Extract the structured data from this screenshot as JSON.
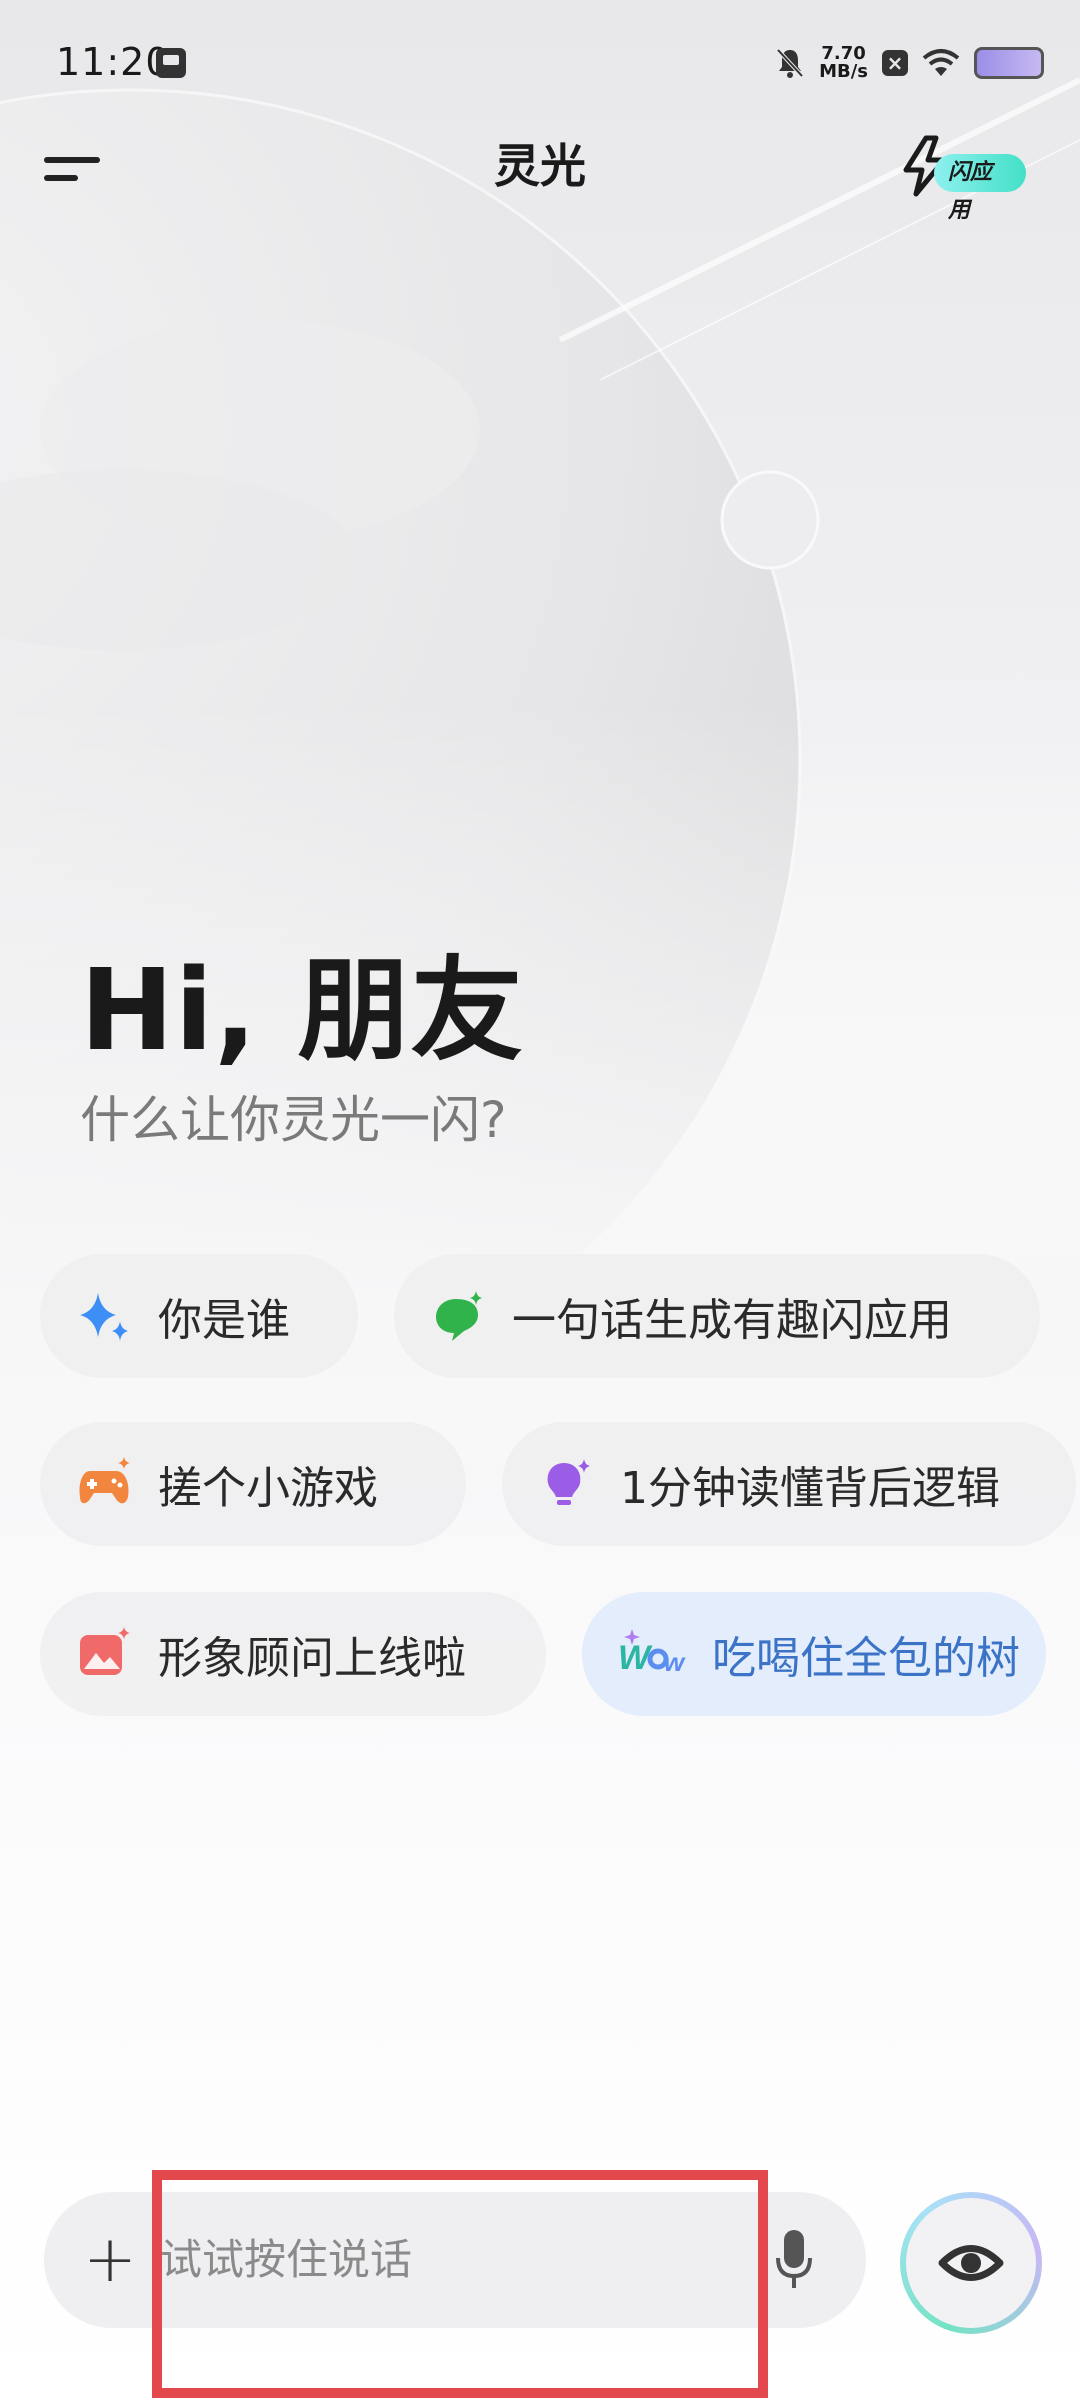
{
  "status_bar": {
    "time": "11:20",
    "speed_value": "7.70",
    "speed_unit": "MB/s",
    "icons": [
      "screenshot-icon",
      "mute-bell-icon",
      "notification-x-icon",
      "wifi-icon",
      "battery-icon"
    ]
  },
  "header": {
    "title": "灵光",
    "flash_app_label": "闪应用"
  },
  "greeting": {
    "title": "Hi, 朋友",
    "subtitle": "什么让你灵光一闪?"
  },
  "suggestions": [
    {
      "label": "你是谁",
      "icon": "sparkle-icon"
    },
    {
      "label": "一句话生成有趣闪应用",
      "icon": "chat-bubble-icon"
    },
    {
      "label": "搓个小游戏",
      "icon": "gamepad-icon"
    },
    {
      "label": "1分钟读懂背后逻辑",
      "icon": "lightbulb-icon"
    },
    {
      "label": "形象顾问上线啦",
      "icon": "image-icon"
    },
    {
      "label": "吃喝住全包的树",
      "icon": "wow-icon",
      "active": true
    }
  ],
  "input": {
    "placeholder": "试试按住说话",
    "add_icon": "plus-icon",
    "mic_icon": "microphone-icon",
    "vision_icon": "eye-icon"
  },
  "colors": {
    "accent_blue": "#3b74c7",
    "highlight_red": "#e3484c",
    "tag_teal": "#43e0c6"
  }
}
